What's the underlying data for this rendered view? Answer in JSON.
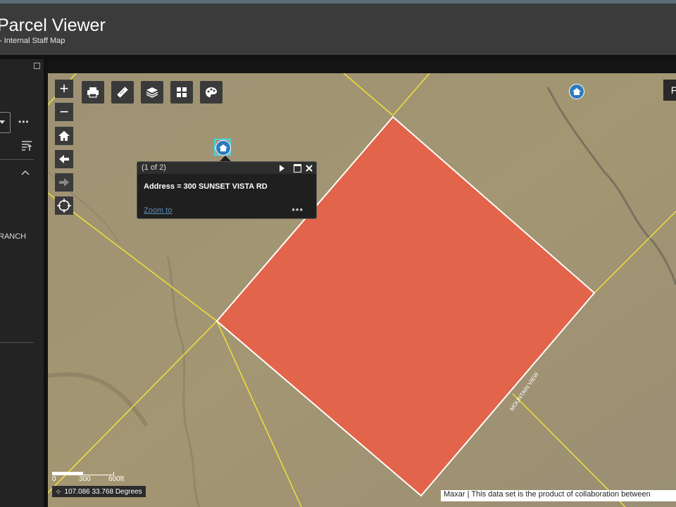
{
  "app": {
    "title": "Parcel Viewer",
    "subtitle": "- Internal Staff Map"
  },
  "sidebar": {
    "result_label": "RANCH"
  },
  "toolbar": {
    "zoom_in": "+",
    "zoom_out": "−",
    "tools": [
      "printer-icon",
      "measure-icon",
      "layers-icon",
      "basemap-gallery-icon",
      "legend-icon"
    ],
    "nav": [
      "home-icon",
      "back-arrow-icon",
      "forward-arrow-icon",
      "locate-icon"
    ]
  },
  "popup": {
    "count": "(1 of 2)",
    "body": "Address = 300 SUNSET VISTA RD",
    "zoom_link": "Zoom to",
    "more": "•••"
  },
  "map": {
    "right_button_label": "F",
    "road_label": "MOUNTAIN VIEW",
    "parcel_color": "#e2644a",
    "parcel_lines_color": "#f0e03c",
    "coordinates": "107.086 33.768 Degrees",
    "scale_labels": [
      "0",
      "300",
      "600ft"
    ],
    "attribution": "Maxar | This data set is the product of collaboration between"
  }
}
